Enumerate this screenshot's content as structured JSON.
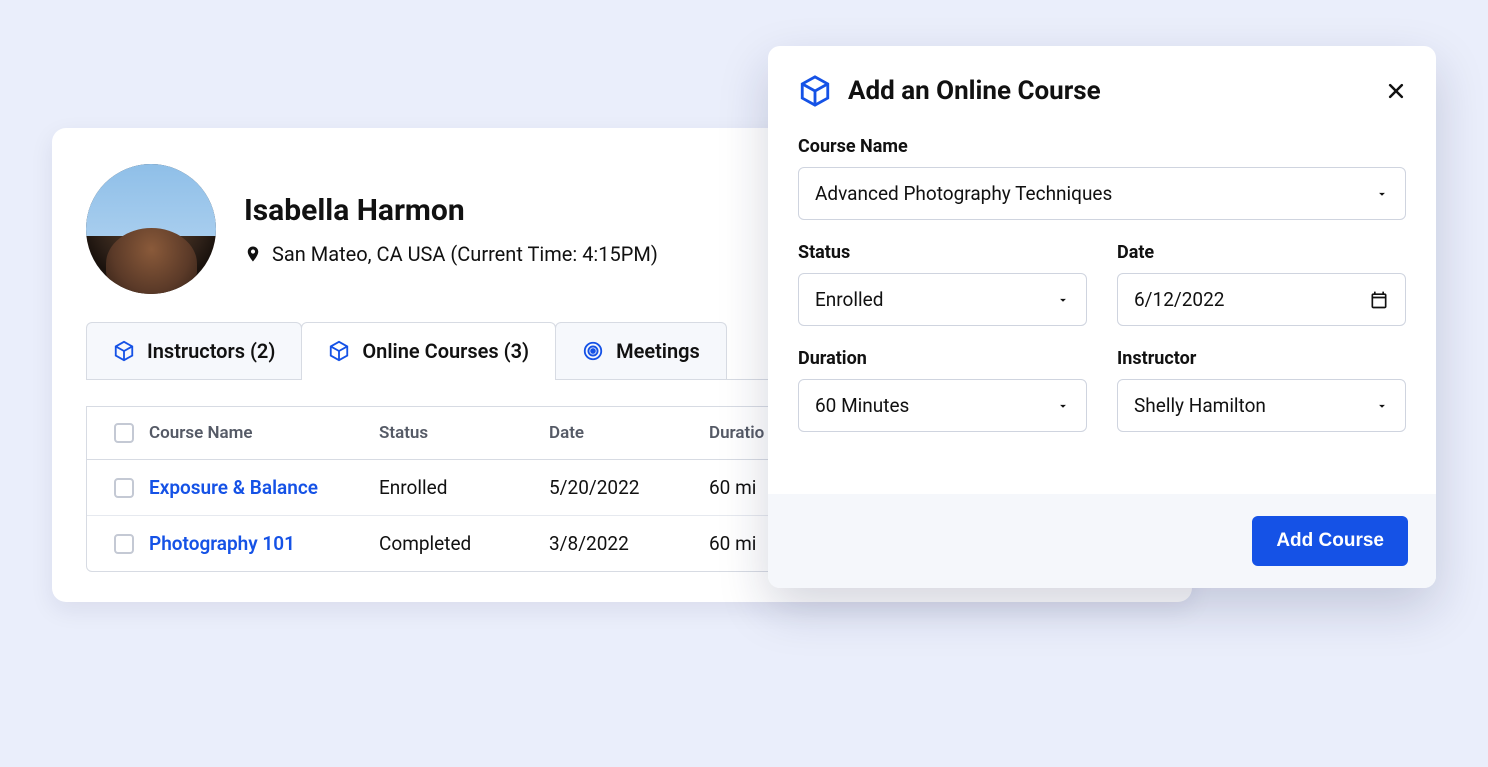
{
  "profile": {
    "name": "Isabella Harmon",
    "location": "San Mateo, CA USA (Current Time: 4:15PM)"
  },
  "tabs": {
    "instructors": "Instructors (2)",
    "courses": "Online Courses (3)",
    "meetings": "Meetings"
  },
  "table": {
    "headers": {
      "course": "Course Name",
      "status": "Status",
      "date": "Date",
      "duration": "Duratio"
    },
    "rows": [
      {
        "course": "Exposure & Balance",
        "status": "Enrolled",
        "date": "5/20/2022",
        "duration": "60 mi"
      },
      {
        "course": "Photography 101",
        "status": "Completed",
        "date": "3/8/2022",
        "duration": "60 mi"
      }
    ]
  },
  "modal": {
    "title": "Add an Online Course",
    "labels": {
      "course_name": "Course Name",
      "status": "Status",
      "date": "Date",
      "duration": "Duration",
      "instructor": "Instructor"
    },
    "values": {
      "course_name": "Advanced Photography Techniques",
      "status": "Enrolled",
      "date": "6/12/2022",
      "duration": "60 Minutes",
      "instructor": "Shelly Hamilton"
    },
    "submit": "Add Course"
  }
}
